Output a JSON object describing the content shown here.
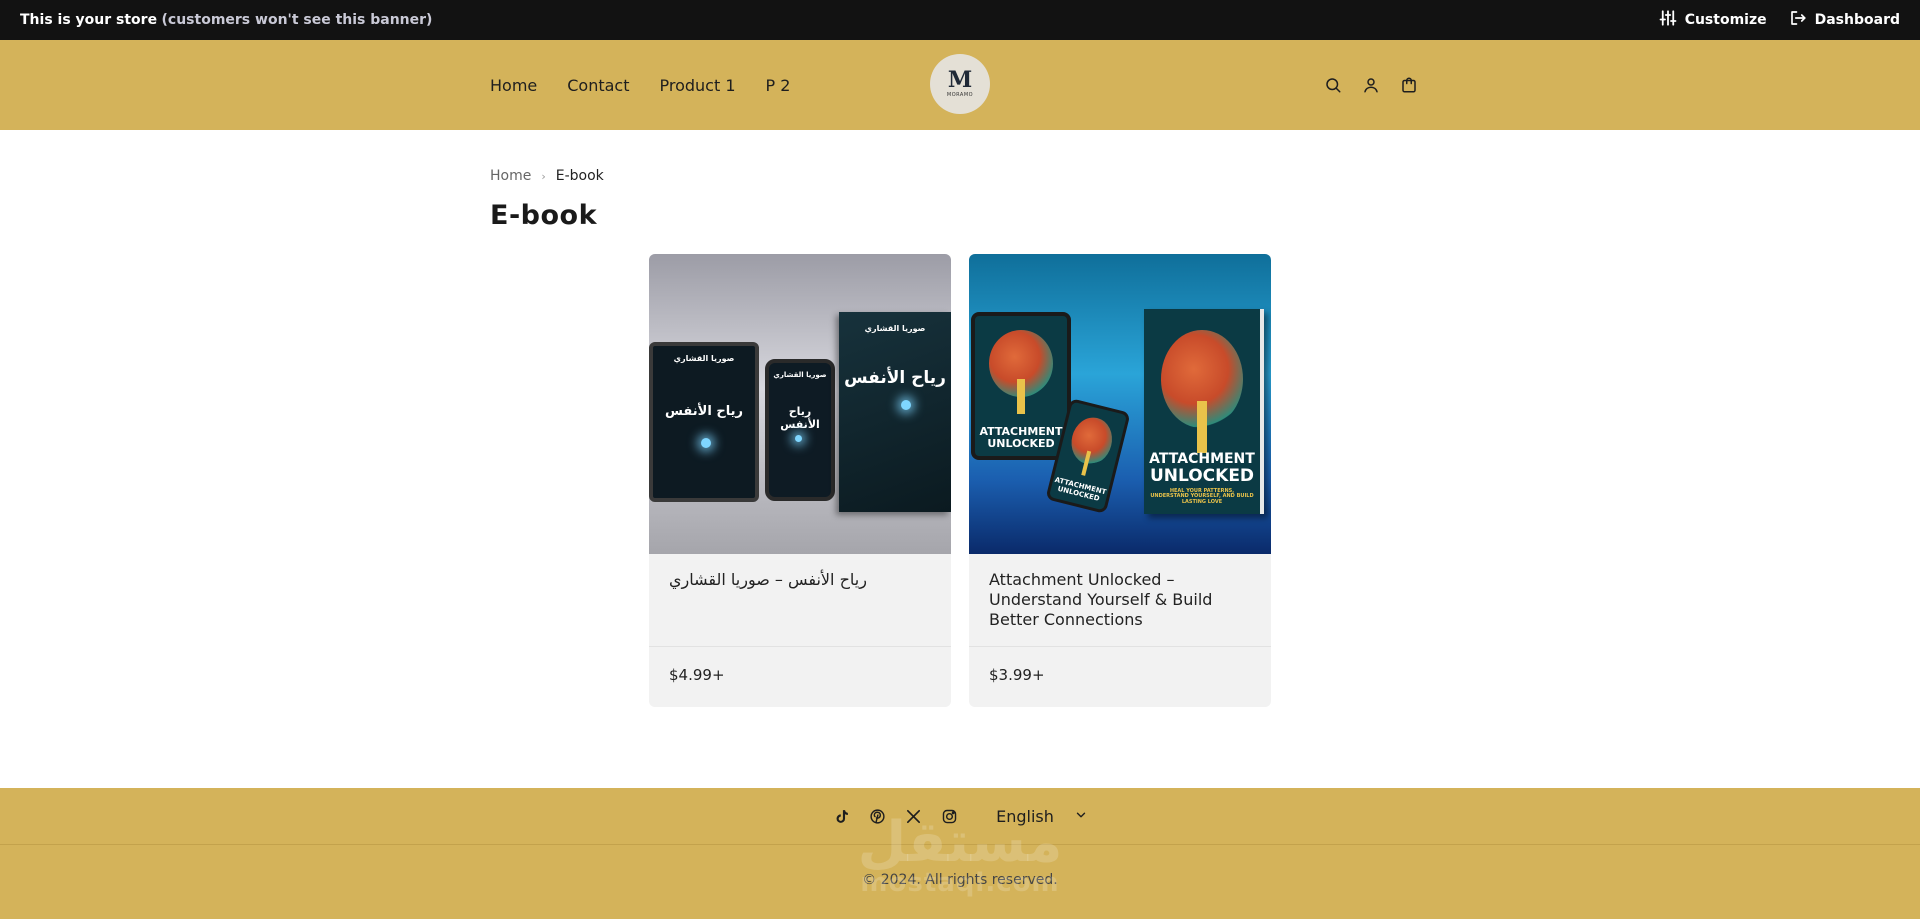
{
  "admin_banner": {
    "store_label": "This is your store",
    "note": "(customers won't see this banner)",
    "customize_label": "Customize",
    "dashboard_label": "Dashboard"
  },
  "header": {
    "nav": [
      "Home",
      "Contact",
      "Product 1",
      "P 2"
    ],
    "logo_mark": "M",
    "logo_word": "MORAMO",
    "icons": [
      "search-icon",
      "account-icon",
      "cart-icon"
    ],
    "background": "#d4b35a"
  },
  "breadcrumb": {
    "home": "Home",
    "separator": "›",
    "current": "E-book"
  },
  "page_title": "E-book",
  "products": [
    {
      "title": "رياح الأنفس – صوريا القشاري",
      "price": "$4.99+",
      "cover_author": "صوريا القشاري",
      "cover_title": "رياح الأنفس"
    },
    {
      "title": "Attachment Unlocked – Understand Yourself & Build Better Connections",
      "price": "$3.99+",
      "cover_title_line1": "ATTACHMENT",
      "cover_title_line2": "UNLOCKED",
      "cover_subtitle": "HEAL YOUR PATTERNS, UNDERSTAND YOURSELF, AND BUILD LASTING LOVE"
    }
  ],
  "footer": {
    "social": [
      "tiktok-icon",
      "pinterest-icon",
      "x-icon",
      "instagram-icon"
    ],
    "language": "English",
    "copyright": "© 2024. All rights reserved.",
    "watermark_ar": "مستقل",
    "watermark_en": "mostaql.com"
  }
}
